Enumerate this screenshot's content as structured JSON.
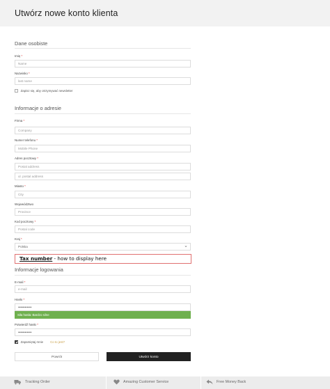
{
  "page": {
    "title": "Utwórz nowe konto klienta"
  },
  "personal": {
    "section_title": "Dane osobiste",
    "first_name": {
      "label": "Imię",
      "required": "*",
      "placeholder": "Name"
    },
    "last_name": {
      "label": "Nazwisko",
      "required": "*",
      "placeholder": "last name"
    },
    "newsletter": {
      "label": "Zapisz się, aby otrzymywać newsletter"
    }
  },
  "address": {
    "section_title": "Informacje o adresie",
    "company": {
      "label": "Firma",
      "required": "*",
      "placeholder": "Company"
    },
    "phone": {
      "label": "Numer telefonu",
      "required": "*",
      "placeholder": "Mobile Phone"
    },
    "street": {
      "label": "Adres pocztowy",
      "required": "*",
      "placeholder_1": "Postal address",
      "placeholder_2": "ul. postal address"
    },
    "city": {
      "label": "Miasto",
      "required": "*",
      "placeholder": "City"
    },
    "region": {
      "label": "Województwo",
      "placeholder": "Province"
    },
    "postcode": {
      "label": "Kod pocztowy",
      "required": "*",
      "placeholder": "Postal code"
    },
    "country": {
      "label": "Kraj",
      "required": "*",
      "value": "Polska"
    }
  },
  "tax": {
    "link_text": "Tax number",
    "rest_text": " - how to display here"
  },
  "login": {
    "section_title": "Informacje logowania",
    "email": {
      "label": "E-mail",
      "required": "*",
      "placeholder": "e-mail"
    },
    "password": {
      "label": "Hasło",
      "required": "*",
      "value": "••••••••••••"
    },
    "strength": {
      "text": "Siła hasła: Bardzo silne"
    },
    "confirm": {
      "label": "Potwierdź hasło",
      "required": "*",
      "value": "••••••••••••"
    },
    "remember": {
      "label": "Zapamiętaj mnie",
      "forgot": "Co to jest?"
    }
  },
  "buttons": {
    "back": "Powrót",
    "create": "Utwórz konto"
  },
  "footer": {
    "items": [
      {
        "label": "Tracking Order",
        "icon": "truck-icon"
      },
      {
        "label": "Amazing Customer Service",
        "icon": "heart-icon"
      },
      {
        "label": "Free Money Back",
        "icon": "return-arrow-icon"
      }
    ]
  },
  "colors": {
    "strength_bar": "#6fb04f",
    "create_button": "#222222",
    "tax_border": "#e07070",
    "forgot_link": "#c9a04a"
  }
}
